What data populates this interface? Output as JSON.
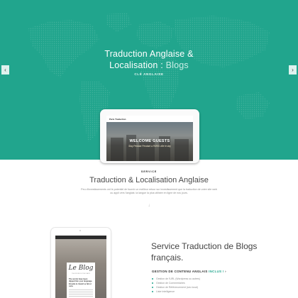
{
  "hero": {
    "title_main": "Traduction Anglaise &",
    "title_line2": "Localisation :",
    "title_accent": "Blogs",
    "subtitle": "CLÉ ANGLAISE",
    "bg_color": "#21a58d",
    "prev_icon": "chevron-left-icon",
    "next_icon": "chevron-right-icon"
  },
  "hero_tablet": {
    "nav_text": "Paris Traduction",
    "welcome": "WELCOME GUESTS",
    "script": "Stay Pedalar Pendant a PARIS ville le day"
  },
  "service": {
    "label": "SERVICE",
    "title": "Traduction & Localisation Anglaise",
    "description": "Peu d'investissements ont le potentiel de fournir un meilleur retour sur investissement que la traduction de votre site web ou appli vers l'anglais: la langue la plus utilisée en ligne de nos jours.",
    "arrow": "↓"
  },
  "blog_tablet": {
    "brand": "Le Blog",
    "meta": "THE WORLDS THE DAYS",
    "post_title": "The words have been dipped Into your language. Ensuite le travail se fait et sans",
    "lines": 6
  },
  "feature": {
    "title": "Service Traduction de Blogs français.",
    "subtitle_main": "GESTION DE CONTENU ANGLAIS",
    "subtitle_accent": "INCLUS !",
    "subtitle_arrow": "›",
    "items": [
      "Gestion de l'URL (Wordpress ou autres)",
      "Gestion de Commentaires",
      "Gestion de Référencement (seo local)",
      "Liste Intelligence"
    ],
    "accent_color": "#21a58d"
  }
}
